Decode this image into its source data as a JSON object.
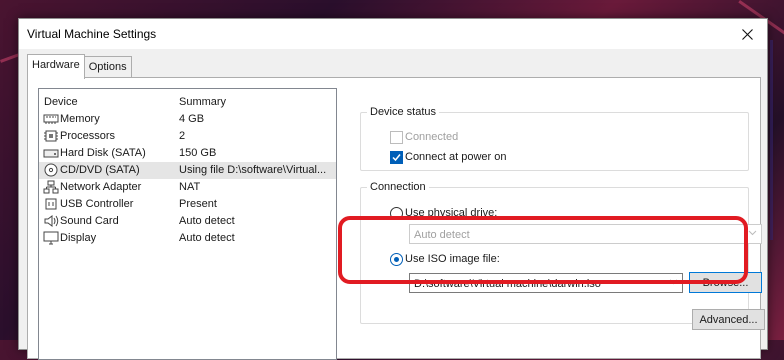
{
  "window": {
    "title": "Virtual Machine Settings"
  },
  "tabs": [
    {
      "label": "Hardware",
      "active": true
    },
    {
      "label": "Options",
      "active": false
    }
  ],
  "device_list": {
    "headers": {
      "device": "Device",
      "summary": "Summary"
    },
    "rows": [
      {
        "icon": "memory-icon",
        "name": "Memory",
        "summary": "4 GB",
        "selected": false
      },
      {
        "icon": "processor-icon",
        "name": "Processors",
        "summary": "2",
        "selected": false
      },
      {
        "icon": "hard-disk-icon",
        "name": "Hard Disk (SATA)",
        "summary": "150 GB",
        "selected": false
      },
      {
        "icon": "cd-dvd-icon",
        "name": "CD/DVD (SATA)",
        "summary": "Using file D:\\software\\Virtual...",
        "selected": true
      },
      {
        "icon": "network-adapter-icon",
        "name": "Network Adapter",
        "summary": "NAT",
        "selected": false
      },
      {
        "icon": "usb-controller-icon",
        "name": "USB Controller",
        "summary": "Present",
        "selected": false
      },
      {
        "icon": "sound-card-icon",
        "name": "Sound Card",
        "summary": "Auto detect",
        "selected": false
      },
      {
        "icon": "display-icon",
        "name": "Display",
        "summary": "Auto detect",
        "selected": false
      }
    ]
  },
  "device_status": {
    "label": "Device status",
    "connected": {
      "label": "Connected",
      "checked": false,
      "enabled": false
    },
    "connect_at_power_on": {
      "label": "Connect at power on",
      "checked": true,
      "enabled": true
    }
  },
  "connection": {
    "label": "Connection",
    "physical_drive": {
      "label": "Use physical drive:",
      "selected": false,
      "value": "Auto detect"
    },
    "iso_image": {
      "label": "Use ISO image file:",
      "selected": true,
      "value": "D:\\software\\Virtual machine\\darwin.iso"
    },
    "browse_label": "Browse...",
    "advanced_label": "Advanced..."
  },
  "colors": {
    "accent": "#005fb8",
    "highlight": "#e11b22"
  }
}
